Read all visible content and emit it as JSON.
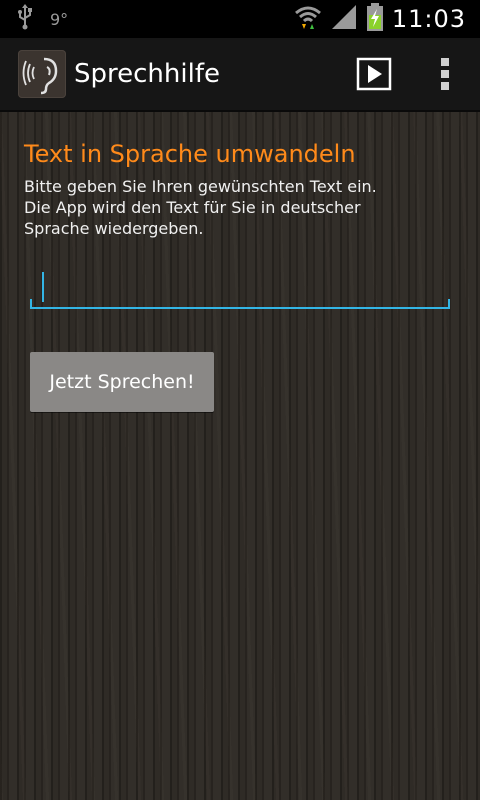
{
  "status_bar": {
    "usb_icon": "usb-icon",
    "notification_number": "9°",
    "wifi_icon": "wifi-icon",
    "signal_icon": "signal-icon",
    "battery_icon": "battery-charging-icon",
    "time": "11:03"
  },
  "action_bar": {
    "app_icon": "ear-icon",
    "title": "Sprechhilfe",
    "play_icon": "play-icon",
    "overflow_icon": "overflow-menu-icon"
  },
  "main": {
    "headline": "Text in Sprache umwandeln",
    "description_lines": [
      "Bitte geben Sie Ihren gewünschten Text ein.",
      "Die App wird den Text für Sie in deutscher",
      "Sprache wiedergeben."
    ],
    "input": {
      "value": "",
      "placeholder": ""
    },
    "speak_button_label": "Jetzt Sprechen!"
  },
  "colors": {
    "accent_orange": "#ff8a1a",
    "input_blue": "#33b5e5",
    "button_gray": "#8a8886"
  }
}
